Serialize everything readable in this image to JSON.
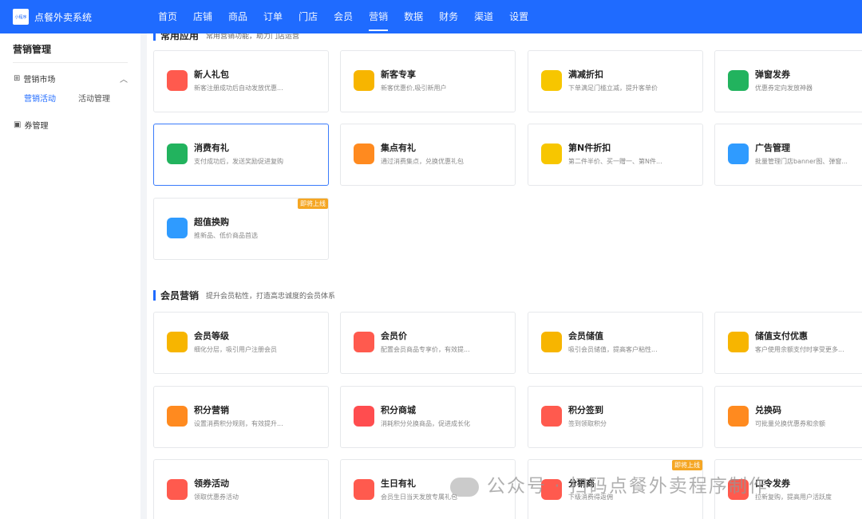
{
  "app": {
    "logo_text": "小程序",
    "name": "点餐外卖系统"
  },
  "nav": [
    {
      "label": "首页",
      "active": false
    },
    {
      "label": "店铺",
      "active": false
    },
    {
      "label": "商品",
      "active": false
    },
    {
      "label": "订单",
      "active": false
    },
    {
      "label": "门店",
      "active": false
    },
    {
      "label": "会员",
      "active": false
    },
    {
      "label": "营销",
      "active": true
    },
    {
      "label": "数据",
      "active": false
    },
    {
      "label": "财务",
      "active": false
    },
    {
      "label": "渠道",
      "active": false
    },
    {
      "label": "设置",
      "active": false
    }
  ],
  "sidebar": {
    "title": "营销管理",
    "group1": "营销市场",
    "sub_active": "营销活动",
    "sub_other": "活动管理",
    "group2": "券管理"
  },
  "section1": {
    "title": "常用应用",
    "desc": "常用营销功能，助力门店运营"
  },
  "section2": {
    "title": "会员营销",
    "desc": "提升会员粘性，打造高忠诚度的会员体系"
  },
  "cards1": [
    {
      "title": "新人礼包",
      "desc": "新客注册成功后自动发放优惠...",
      "icon": "gift-icon",
      "color": "#ff5a4e"
    },
    {
      "title": "新客专享",
      "desc": "新客优惠价,吸引新用户",
      "icon": "medal-icon",
      "color": "#f7b500"
    },
    {
      "title": "满减折扣",
      "desc": "下单满足门槛立减，提升客单价",
      "icon": "tag-icon",
      "color": "#f7c600"
    },
    {
      "title": "弹窗发券",
      "desc": "优惠券定向发放神器",
      "icon": "coupon-envelope-icon",
      "color": "#22b35e"
    },
    {
      "title": "消费有礼",
      "desc": "支付成功后，发送奖励促进复购",
      "icon": "envelope-icon",
      "color": "#22b35e"
    },
    {
      "title": "集点有礼",
      "desc": "通过消费集点，兑换优惠礼包",
      "icon": "coin-icon",
      "color": "#ff8a1f"
    },
    {
      "title": "第N件折扣",
      "desc": "第二件半价、买一赠一、第N件...",
      "icon": "tag-icon",
      "color": "#f7c600"
    },
    {
      "title": "广告管理",
      "desc": "批量管理门店banner图、弹窗...",
      "icon": "image-icon",
      "color": "#2f9bff"
    },
    {
      "title": "超值换购",
      "desc": "推新品、低价商品首选",
      "icon": "image-icon",
      "color": "#2f9bff",
      "badge": "即将上线"
    }
  ],
  "cards2": [
    {
      "title": "会员等级",
      "desc": "细化分层，吸引用户注册会员",
      "icon": "vip-card-icon",
      "color": "#f7b500"
    },
    {
      "title": "会员价",
      "desc": "配置会员商品专享价，有效提...",
      "icon": "price-tag-icon",
      "color": "#ff5a4e"
    },
    {
      "title": "会员储值",
      "desc": "吸引会员储值，提高客户粘性...",
      "icon": "coin-icon",
      "color": "#f7b500"
    },
    {
      "title": "储值支付优惠",
      "desc": "客户使用余额支付时享受更多...",
      "icon": "coin-icon",
      "color": "#f7b500"
    },
    {
      "title": "积分营销",
      "desc": "设置消费积分规则，有效提升...",
      "icon": "points-icon",
      "color": "#ff8a1f"
    },
    {
      "title": "积分商城",
      "desc": "消耗积分兑换商品，促进成长化",
      "icon": "gem-icon",
      "color": "#ff4d4f"
    },
    {
      "title": "积分签到",
      "desc": "签到领取积分",
      "icon": "bag-icon",
      "color": "#ff5a4e"
    },
    {
      "title": "兑换码",
      "desc": "可批量兑换优惠券和余额",
      "icon": "redeem-icon",
      "color": "#ff8a1f"
    },
    {
      "title": "领券活动",
      "desc": "领取优惠券活动",
      "icon": "coupon-icon",
      "color": "#ff5a4e"
    },
    {
      "title": "生日有礼",
      "desc": "会员生日当天发放专属礼包",
      "icon": "gift-icon",
      "color": "#ff5a4e"
    },
    {
      "title": "分销商",
      "desc": "下级消费得返佣",
      "icon": "share-icon",
      "color": "#ff5a4e",
      "badge": "即将上线"
    },
    {
      "title": "口令发券",
      "desc": "拉新复购，提高用户活跃度",
      "icon": "coupon-icon",
      "color": "#ff5a4e"
    }
  ],
  "watermark": "公众号 · 扫码点餐外卖程序制作"
}
